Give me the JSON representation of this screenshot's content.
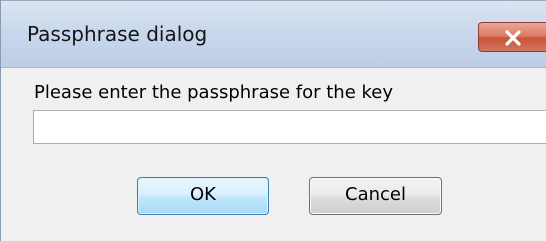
{
  "dialog": {
    "title": "Passphrase dialog",
    "prompt": "Please enter the passphrase for the key",
    "passphrase_value": "",
    "ok_label": "OK",
    "cancel_label": "Cancel"
  },
  "icons": {
    "close": "close-icon"
  },
  "colors": {
    "close_button": "#c85639",
    "title_bar": "#c9d8ec",
    "default_button_border": "#3c7fb1",
    "dialog_background": "#f0f0f0"
  }
}
